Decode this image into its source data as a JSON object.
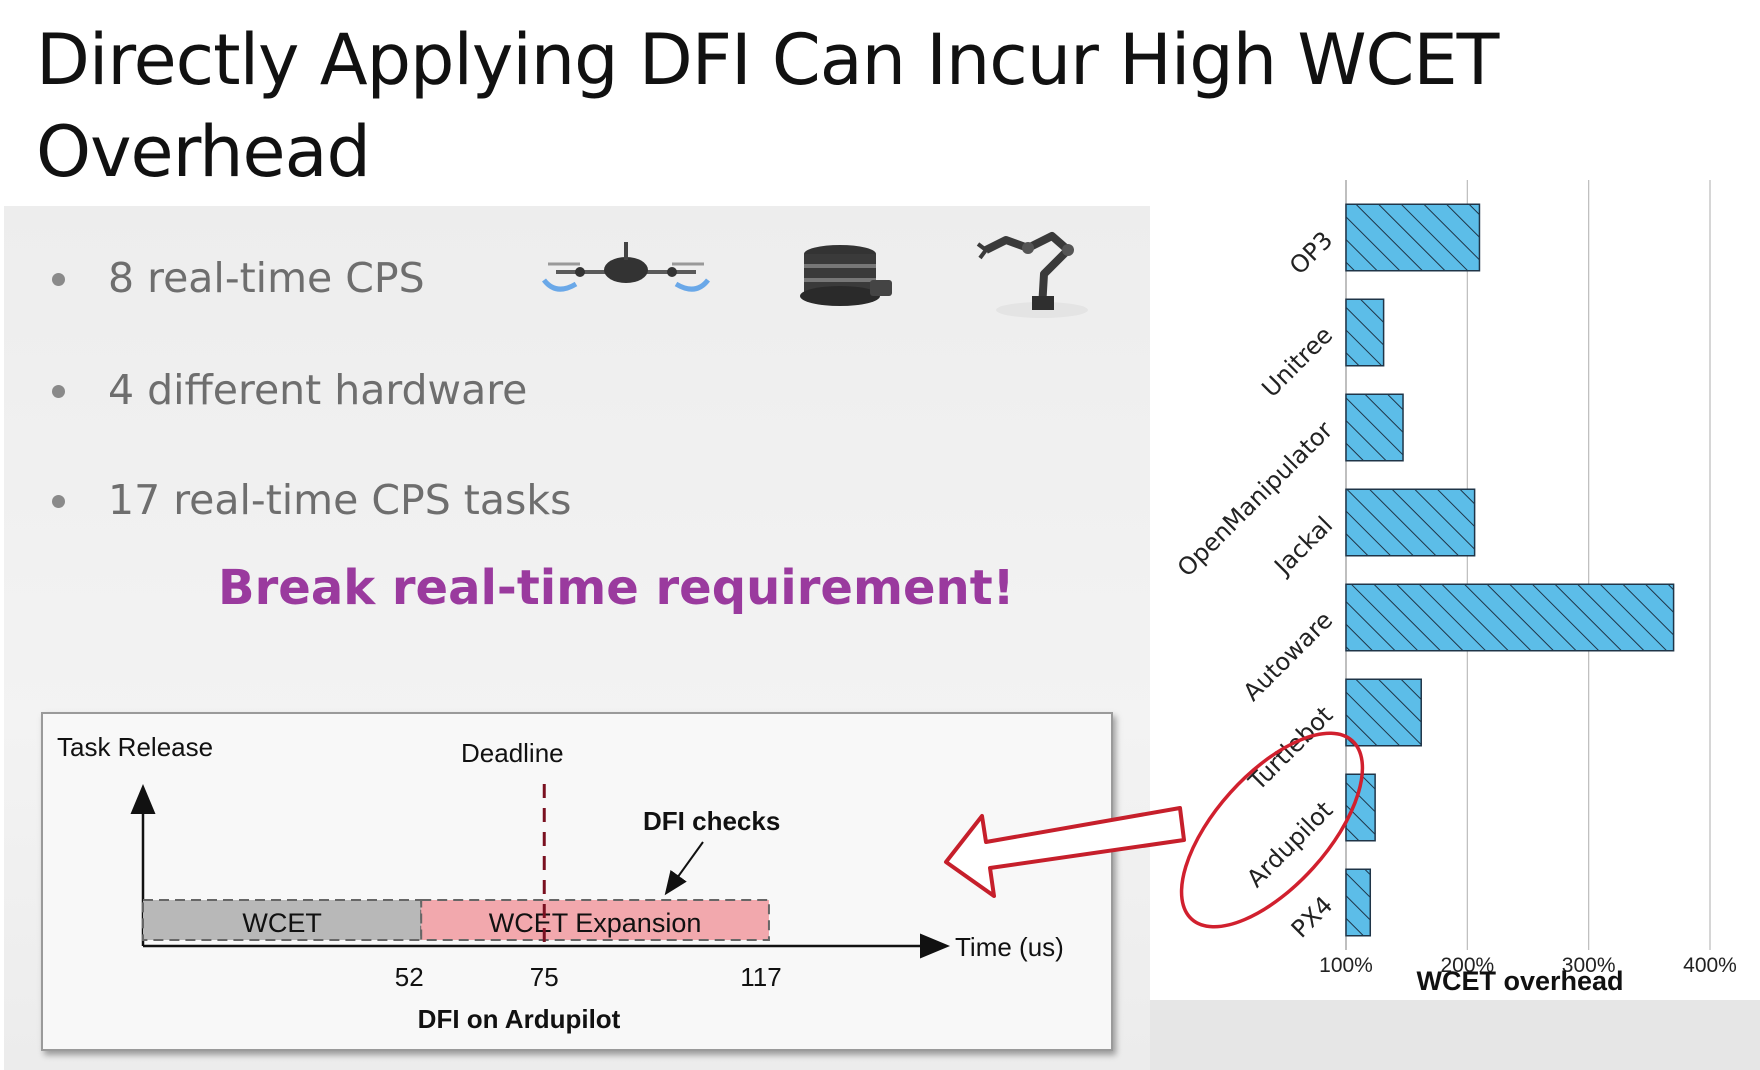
{
  "slide": {
    "title": "Directly Applying DFI Can Incur High WCET Overhead"
  },
  "bullets": [
    {
      "text": "8 real-time CPS"
    },
    {
      "text": "4 different hardware"
    },
    {
      "text": "17 real-time CPS tasks"
    }
  ],
  "callout": "Break real-time requirement!",
  "robot_images": [
    "quadcopter-drone-icon",
    "turtlebot-robot-icon",
    "robot-arm-icon"
  ],
  "timeline": {
    "task_release_label": "Task Release",
    "deadline_label": "Deadline",
    "dfi_checks_label": "DFI checks",
    "wcet_label": "WCET",
    "expansion_label": "WCET Expansion",
    "time_axis_label": "Time (us)",
    "tick_52": "52",
    "tick_75": "75",
    "tick_117": "117",
    "caption": "DFI on Ardupilot",
    "wcet_end": 52,
    "deadline": 75,
    "expansion_end": 117,
    "colors": {
      "wcet": "#b8b8b8",
      "expansion": "#f2a8ad",
      "deadline": "#7a1020"
    }
  },
  "chart_data": {
    "type": "bar",
    "orientation": "horizontal",
    "categories": [
      "OP3",
      "Unitree",
      "OpenManipulator",
      "Jackal",
      "Autoware",
      "Turtlebot",
      "Ardupilot",
      "PX4"
    ],
    "values": [
      210,
      131,
      147,
      206,
      370,
      162,
      124,
      120
    ],
    "xticks": [
      "100%",
      "200%",
      "300%",
      "400%"
    ],
    "xtick_values": [
      100,
      200,
      300,
      400
    ],
    "xlabel": "WCET overhead",
    "xlim": [
      100,
      400
    ],
    "grid": true,
    "highlight": "Ardupilot",
    "bar_color": "#5cbde8",
    "hatch": "diagonal",
    "highlight_color": "#d1202e"
  }
}
